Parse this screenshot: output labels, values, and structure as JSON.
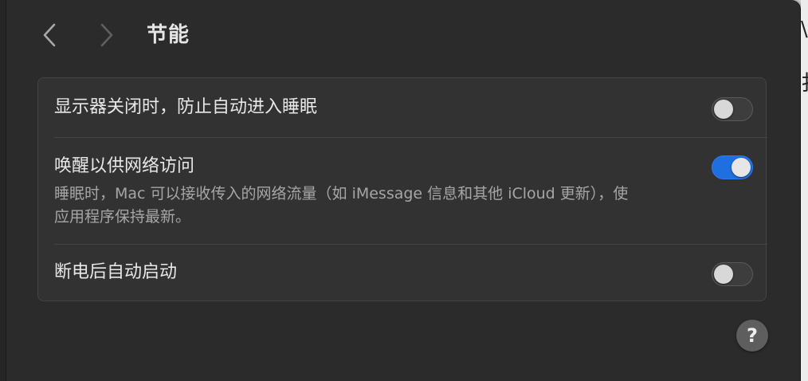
{
  "header": {
    "title": "节能",
    "back_icon": "chevron-left-icon",
    "forward_icon": "chevron-right-icon"
  },
  "settings": [
    {
      "label": "显示器关闭时，防止自动进入睡眠",
      "enabled": false
    },
    {
      "label": "唤醒以供网络访问",
      "description_line1": "睡眠时，Mac 可以接收传入的网络流量（如 iMessage 信息和其他 iCloud 更新），使",
      "description_line2": "应用程序保持最新。",
      "enabled": true
    },
    {
      "label": "断电后自动启动",
      "enabled": false
    }
  ],
  "help": {
    "label": "?",
    "icon": "help-icon"
  },
  "colors": {
    "toggle_on": "#1f6fe0",
    "background": "#2b2b2b"
  }
}
